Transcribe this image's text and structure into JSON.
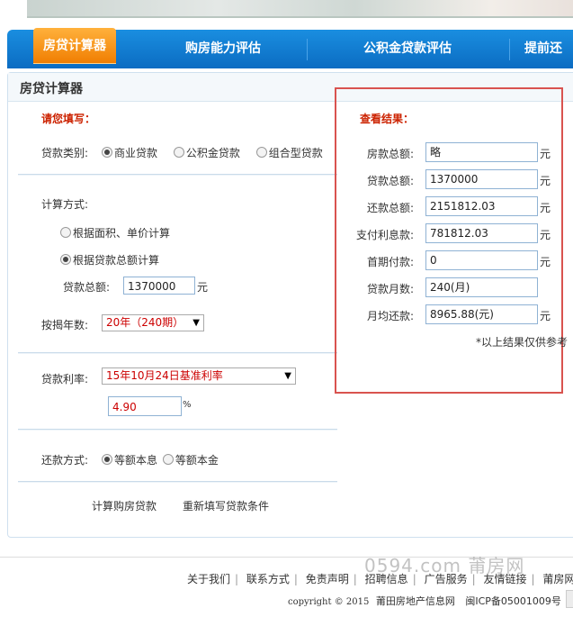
{
  "nav": {
    "active": "房贷计算器",
    "items": [
      "购房能力评估",
      "公积金贷款评估",
      "提前还"
    ]
  },
  "panel": {
    "title": "房贷计算器"
  },
  "form": {
    "heading": "请您填写：",
    "loan_type_label": "贷款类别:",
    "loan_types": [
      "商业贷款",
      "公积金贷款",
      "组合型贷款"
    ],
    "calc_method_label": "计算方式:",
    "calc_methods": [
      "根据面积、单价计算",
      "根据贷款总额计算"
    ],
    "loan_total_label": "贷款总额:",
    "loan_total_value": "1370000",
    "loan_total_unit": "元",
    "years_label": "按揭年数:",
    "years_value": "20年（240期）",
    "rate_label": "贷款利率:",
    "rate_value": "15年10月24日基准利率",
    "rate_number": "4.90",
    "rate_unit": "%",
    "repay_label": "还款方式:",
    "repay_methods": [
      "等额本息",
      "等额本金"
    ],
    "calc_button": "计算购房贷款",
    "reset_button": "重新填写贷款条件"
  },
  "result": {
    "heading": "查看结果：",
    "rows": [
      {
        "label": "房款总额:",
        "value": "略",
        "unit": "元"
      },
      {
        "label": "贷款总额:",
        "value": "1370000",
        "unit": "元"
      },
      {
        "label": "还款总额:",
        "value": "2151812.03",
        "unit": "元"
      },
      {
        "label": "支付利息款:",
        "value": "781812.03",
        "unit": "元"
      },
      {
        "label": "首期付款:",
        "value": "0",
        "unit": "元"
      },
      {
        "label": "贷款月数:",
        "value": "240(月)",
        "unit": ""
      },
      {
        "label": "月均还款:",
        "value": "8965.88(元)",
        "unit": "元"
      }
    ],
    "note": "*以上结果仅供参考"
  },
  "footer": {
    "links": [
      "关于我们",
      "联系方式",
      "免责声明",
      "招聘信息",
      "广告服务",
      "友情链接",
      "莆房网"
    ],
    "copyright_prefix": "copyright © 2015",
    "company": "莆田房地产信息网",
    "icp": "闽ICP备05001009号"
  },
  "watermark": "0594.com 莆房网",
  "colors": {
    "nav_blue": "#0b6cc2",
    "active_orange": "#f07d00",
    "highlight_red": "#d9534f"
  }
}
